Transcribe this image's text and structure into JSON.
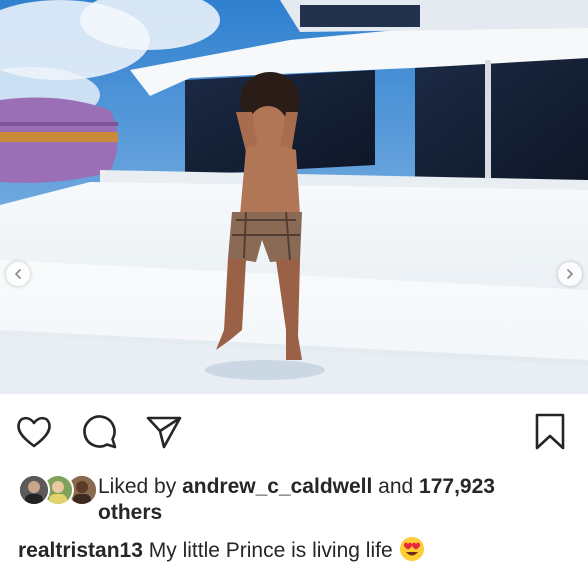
{
  "post": {
    "image_alt_icon": "photo",
    "carousel": {
      "prev_icon": "chevron-left-icon",
      "next_icon": "chevron-right-icon"
    },
    "actions": {
      "like_icon": "heart-icon",
      "comment_icon": "comment-icon",
      "share_icon": "paper-plane-icon",
      "save_icon": "bookmark-icon"
    },
    "likes": {
      "prefix": "Liked by ",
      "user": "andrew_c_caldwell",
      "middle": " and ",
      "count": "177,923",
      "suffix": "others"
    },
    "caption": {
      "username": "realtristan13",
      "text": " My little Prince is living life",
      "emoji_icon": "heart-eyes-emoji-icon"
    }
  },
  "colors": {
    "icon": "#262626",
    "sky": "#3f8fd6",
    "boat_white": "#f3f6f8",
    "inflatable": "#9a6fb5"
  }
}
